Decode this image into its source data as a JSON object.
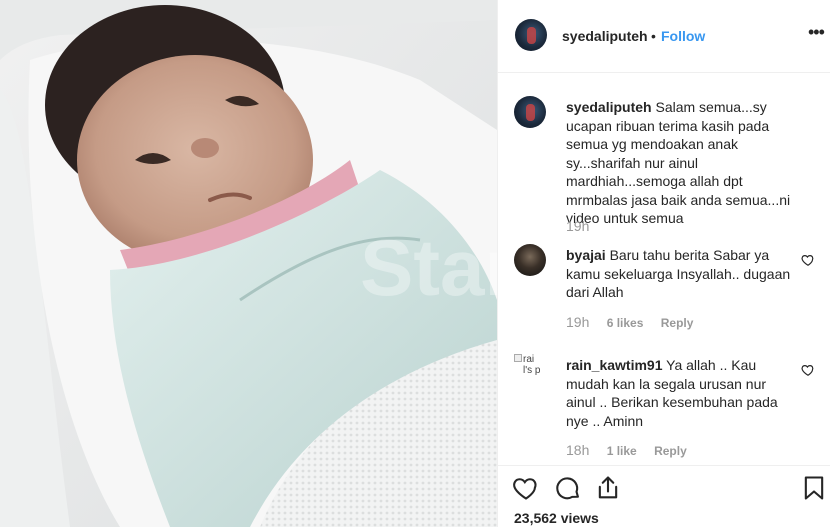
{
  "media": {
    "watermark": "Star"
  },
  "header": {
    "username": "syedaliputeh",
    "separator": "•",
    "follow_label": "Follow",
    "more_label": "•••"
  },
  "comments": [
    {
      "username": "syedaliputeh",
      "text": "Salam semua...sy ucapan ribuan terima kasih pada semua yg mendoakan anak sy...sharifah nur ainul mardhiah...semoga allah dpt mrmbalas jasa baik anda semua...ni video untuk semua",
      "time": "19h"
    },
    {
      "username": "byajai",
      "text": "Baru tahu berita Sabar ya kamu sekeluarga Insyallah.. dugaan dari Allah",
      "time": "19h",
      "likes": "6 likes",
      "reply": "Reply"
    },
    {
      "username": "rain_kawtim91",
      "avatar_alt": "rai l's p",
      "text": "Ya allah .. Kau mudah kan la segala urusan nur ainul .. Berikan kesembuhan pada nye .. Aminn",
      "time": "18h",
      "likes": "1 like",
      "reply": "Reply"
    }
  ],
  "actions": {
    "views": "23,562 views"
  },
  "colors": {
    "link_blue": "#3897f0",
    "text": "#262626",
    "muted": "#999999",
    "divider": "#efefef"
  },
  "icons": [
    "heart-icon",
    "comment-icon",
    "share-icon",
    "bookmark-icon",
    "more-options-icon"
  ]
}
